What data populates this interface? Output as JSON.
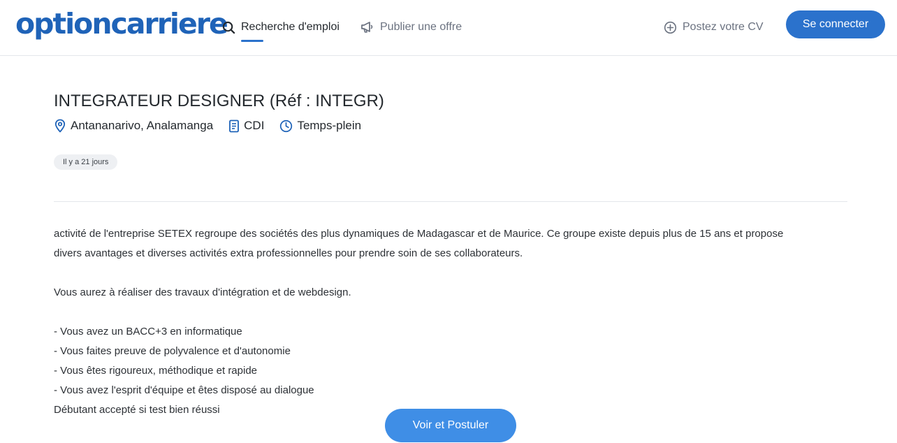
{
  "header": {
    "logo": "optioncarriere",
    "nav": {
      "search_label": "Recherche d'emploi",
      "publish_label": "Publier une offre",
      "cv_label": "Postez votre CV"
    },
    "login_label": "Se connecter"
  },
  "job": {
    "title": "INTEGRATEUR DESIGNER (Réf : INTEGR)",
    "location": "Antananarivo, Analamanga",
    "contract": "CDI",
    "schedule": "Temps-plein",
    "posted": "Il y a 21 jours",
    "description": {
      "intro_1": "activité de l'entreprise SETEX regroupe des sociétés des plus dynamiques de Madagascar et de Maurice. Ce groupe existe depuis plus de 15 ans et propose",
      "intro_2": "divers avantages et diverses activités extra professionnelles pour prendre soin de ses collaborateurs.",
      "task": "Vous aurez à réaliser des travaux d'intégration et de webdesign.",
      "req_1": "- Vous avez un BACC+3 en informatique",
      "req_2": "- Vous faites preuve de polyvalence et d'autonomie",
      "req_3": "- Vous êtes rigoureux, méthodique et rapide",
      "req_4": "- Vous avez l'esprit d'équipe et êtes disposé au dialogue",
      "note": "Débutant accepté si test bien réussi"
    },
    "apply_label": "Voir et Postuler"
  },
  "colors": {
    "brand": "#1f63b8",
    "primary_button": "#2b72cc",
    "apply_button": "#3f8ee6",
    "icon_blue": "#1f63b8"
  },
  "icons": [
    "search-icon",
    "megaphone-icon",
    "plus-circle-icon",
    "location-pin-icon",
    "document-icon",
    "clock-icon"
  ]
}
